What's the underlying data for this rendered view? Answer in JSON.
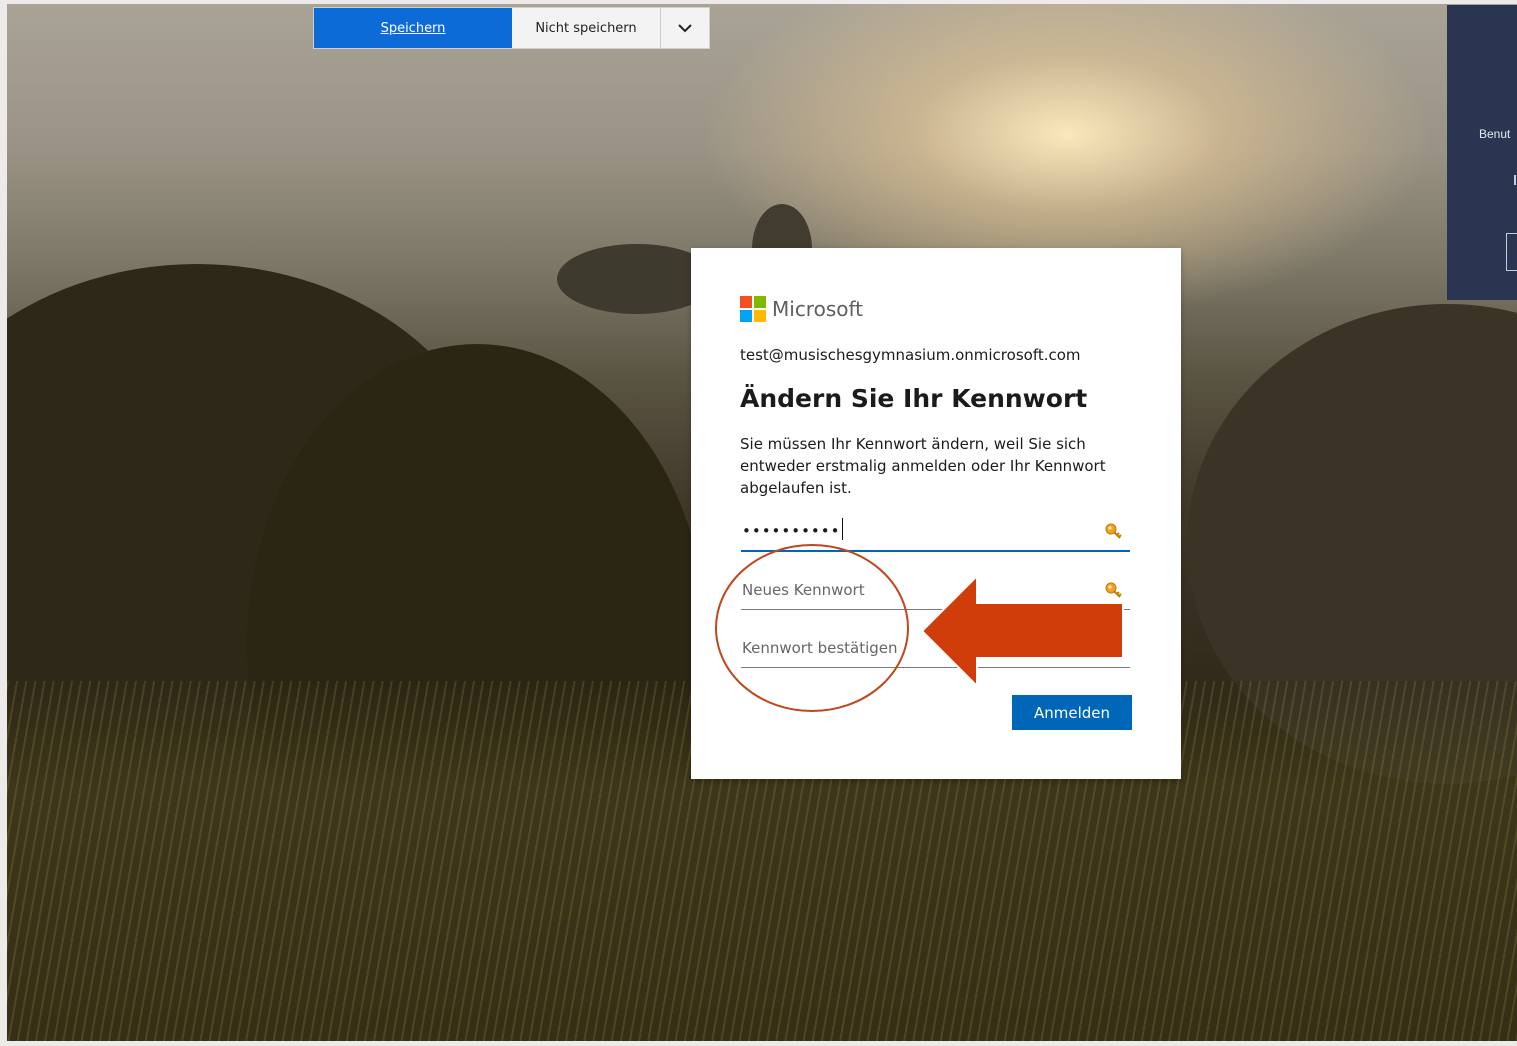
{
  "save_bar": {
    "save_label": "Speichern",
    "no_save_label": "Nicht speichern",
    "menu_icon": "chevron-down-icon"
  },
  "right_panel": {
    "text": "Benut"
  },
  "dialog": {
    "brand": "Microsoft",
    "email": "test@musischesgymnasium.onmicrosoft.com",
    "title": "Ändern Sie Ihr Kennwort",
    "description": "Sie müssen Ihr Kennwort ändern, weil Sie sich entweder erstmalig anmelden oder Ihr Kennwort abgelaufen ist.",
    "current_password_value": "••••••••••",
    "new_password_placeholder": "Neues Kennwort",
    "confirm_password_placeholder": "Kennwort bestätigen",
    "submit_label": "Anmelden",
    "key_icon": "key-icon",
    "logo_colors": [
      "#f25022",
      "#7fba00",
      "#00a4ef",
      "#ffb900"
    ]
  },
  "annotation": {
    "arrow_color": "#d03c0a",
    "circle_color": "#c0461c"
  }
}
